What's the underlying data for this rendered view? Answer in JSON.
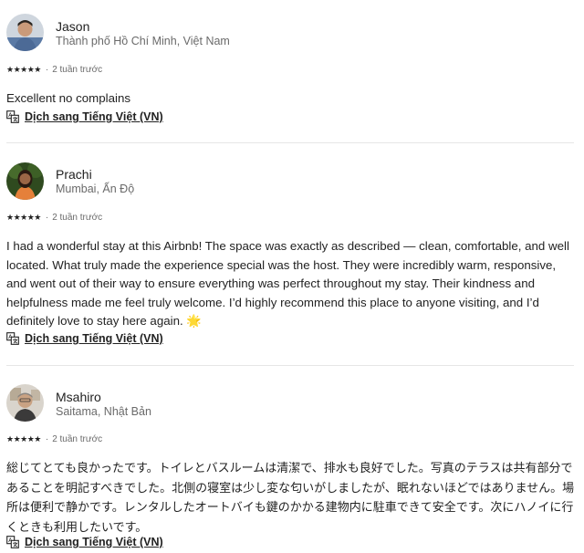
{
  "reviews": [
    {
      "name": "Jason",
      "location": "Thành phố Hồ Chí Minh, Việt Nam",
      "rating": 5,
      "stars": "★★★★★",
      "date": "2 tuần trước",
      "text": "Excellent no complains",
      "translate_label": "Dịch sang Tiếng Việt (VN)"
    },
    {
      "name": "Prachi",
      "location": "Mumbai, Ấn Độ",
      "rating": 5,
      "stars": "★★★★★",
      "date": "2 tuần trước",
      "text": "I had a wonderful stay at this Airbnb! The space was exactly as described — clean, comfortable, and well located. What truly made the experience special was the host. They were incredibly warm, responsive, and went out of their way to ensure everything was perfect throughout my stay. Their kindness and helpfulness made me feel truly welcome. I’d highly recommend this place to anyone visiting, and I’d definitely love to stay here again. 🌟",
      "translate_label": "Dịch sang Tiếng Việt (VN)"
    },
    {
      "name": "Msahiro",
      "location": "Saitama, Nhật Bản",
      "rating": 5,
      "stars": "★★★★★",
      "date": "2 tuần trước",
      "text": "総じてとても良かったです。トイレとバスルームは清潔で、排水も良好でした。写真のテラスは共有部分であることを明記すべきでした。北側の寝室は少し変な匂いがしましたが、眠れないほどではありません。場所は便利で静かです。レンタルしたオートバイも鍵のかかる建物内に駐車できて安全です。次にハノイに行くときも利用したいです。",
      "translate_label": "Dịch sang Tiếng Việt (VN)"
    }
  ],
  "separator": "·",
  "icons": {
    "translate": "translate-icon",
    "avatar": "avatar"
  }
}
